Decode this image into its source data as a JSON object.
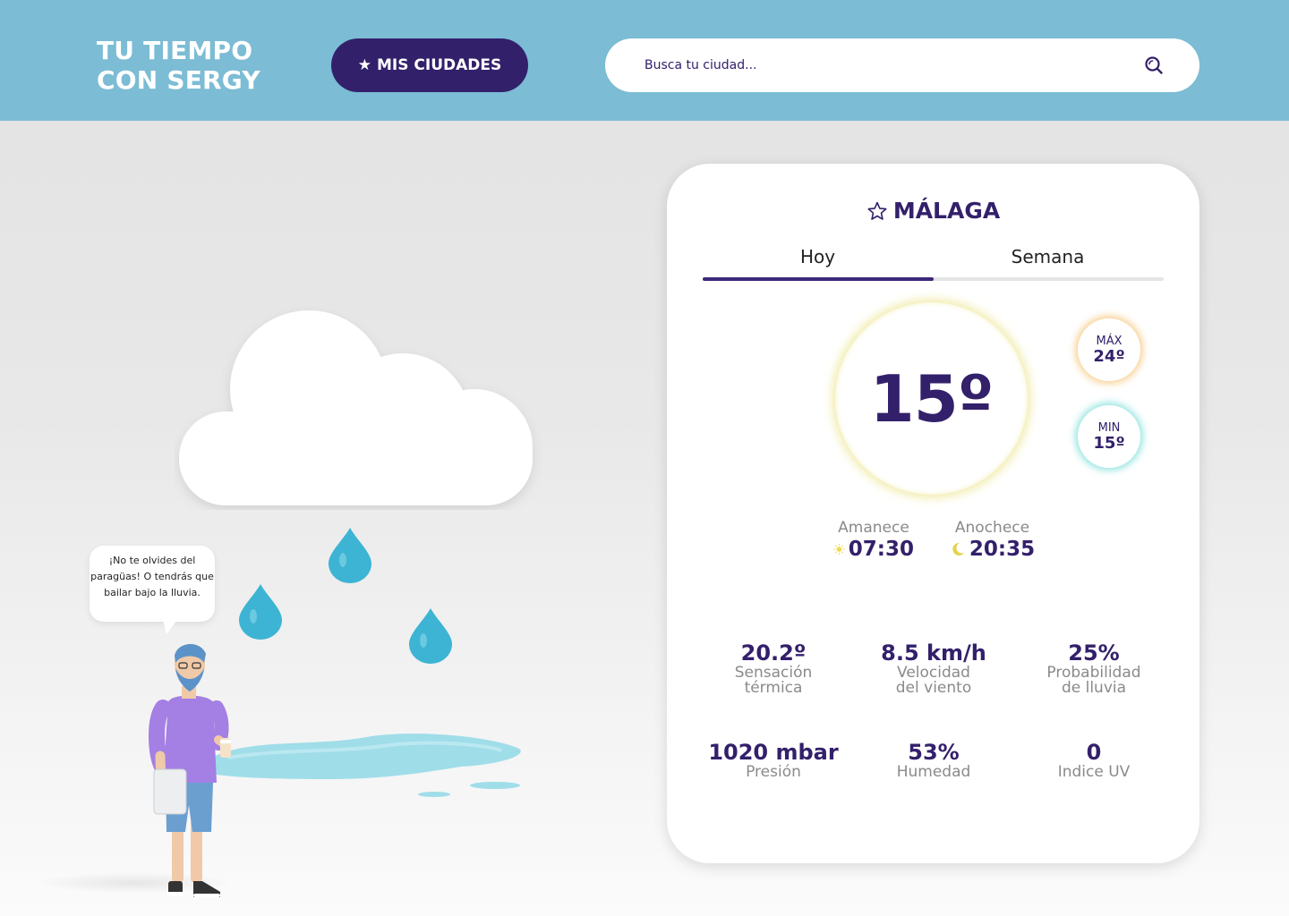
{
  "header": {
    "brand_line1": "TU TIEMPO",
    "brand_line2": "CON SERGY",
    "cities_button": "MIS CIUDADES",
    "search_placeholder": "Busca tu ciudad..."
  },
  "illustration": {
    "speech_bubble": "¡No te olvides del paragüas! O tendrás que bailar bajo la lluvia."
  },
  "weather": {
    "city": "MÁLAGA",
    "tabs": [
      "Hoy",
      "Semana"
    ],
    "active_tab": "Hoy",
    "current_temp": "15º",
    "max_label": "MÁX",
    "max_value": "24º",
    "min_label": "MIN",
    "min_value": "15º",
    "sunrise_label": "Amanece",
    "sunrise_time": "07:30",
    "sunset_label": "Anochece",
    "sunset_time": "20:35",
    "stats": [
      {
        "value": "20.2º",
        "label1": "Sensación",
        "label2": "térmica"
      },
      {
        "value": "8.5 km/h",
        "label1": "Velocidad",
        "label2": "del viento"
      },
      {
        "value": "25%",
        "label1": "Probabilidad",
        "label2": "de lluvia"
      },
      {
        "value": "1020 mbar",
        "label1": "Presión",
        "label2": ""
      },
      {
        "value": "53%",
        "label1": "Humedad",
        "label2": ""
      },
      {
        "value": "0",
        "label1": "Indice UV",
        "label2": ""
      }
    ]
  },
  "colors": {
    "header_bg": "#7cbcd5",
    "primary": "#33206b",
    "muted_text": "#8a8a8a",
    "water": "#3db4d3"
  }
}
